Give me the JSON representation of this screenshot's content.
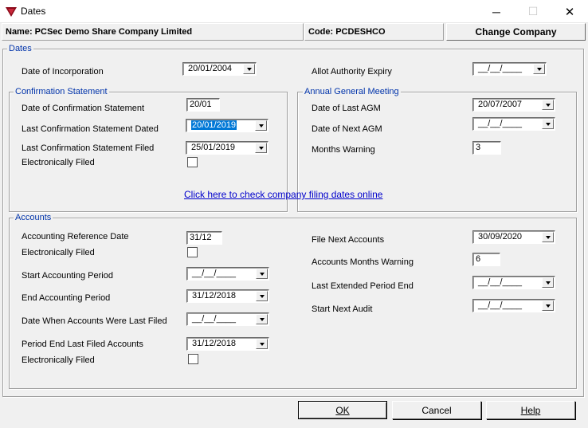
{
  "window": {
    "title": "Dates",
    "minimize_glyph": "─",
    "maximize_glyph": "☐",
    "close_glyph": "✕"
  },
  "info": {
    "company_name": "Name: PCSec Demo Share Company Limited",
    "company_code": "Code: PCDESHCO",
    "change_company": "Change Company"
  },
  "dates": {
    "legend": "Dates",
    "incorporation_label": "Date of Incorporation",
    "incorporation_value": "20/01/2004",
    "allot_expiry_label": "Allot Authority Expiry",
    "allot_expiry_value": "__/__/____"
  },
  "confirmation": {
    "legend": "Confirmation Statement",
    "date_label": "Date of Confirmation Statement",
    "date_value": "20/01",
    "last_dated_label": "Last Confirmation Statement Dated",
    "last_dated_value": "20/01/2019",
    "last_filed_label": "Last Confirmation Statement Filed",
    "last_filed_value": "25/01/2019",
    "e_filed_label": "Electronically Filed"
  },
  "agm": {
    "legend": "Annual General Meeting",
    "last_label": "Date of Last AGM",
    "last_value": "20/07/2007",
    "next_label": "Date of Next AGM",
    "next_value": "__/__/____",
    "warning_label": "Months Warning",
    "warning_value": "3"
  },
  "link_text": "Click here to check company filing dates online",
  "accounts": {
    "legend": "Accounts",
    "ref_date_label": "Accounting Reference Date",
    "ref_date_value": "31/12",
    "e_filed_label": "Electronically Filed",
    "start_label": "Start Accounting Period",
    "start_value": "__/__/____",
    "end_label": "End Accounting Period",
    "end_value": "31/12/2018",
    "last_filed_label": "Date When Accounts Were Last Filed",
    "last_filed_value": "__/__/____",
    "period_end_label": "Period End Last Filed Accounts",
    "period_end_value": "31/12/2018",
    "e_filed2_label": "Electronically Filed",
    "file_next_label": "File Next Accounts",
    "file_next_value": "30/09/2020",
    "months_warning_label": "Accounts Months Warning",
    "months_warning_value": "6",
    "extended_label": "Last Extended Period End",
    "extended_value": "__/__/____",
    "audit_label": "Start Next Audit",
    "audit_value": "__/__/____"
  },
  "buttons": {
    "ok": "OK",
    "cancel": "Cancel",
    "help": "Help"
  },
  "colors": {
    "legend": "#0033aa",
    "link": "#0000cc",
    "selection": "#0078d7"
  }
}
